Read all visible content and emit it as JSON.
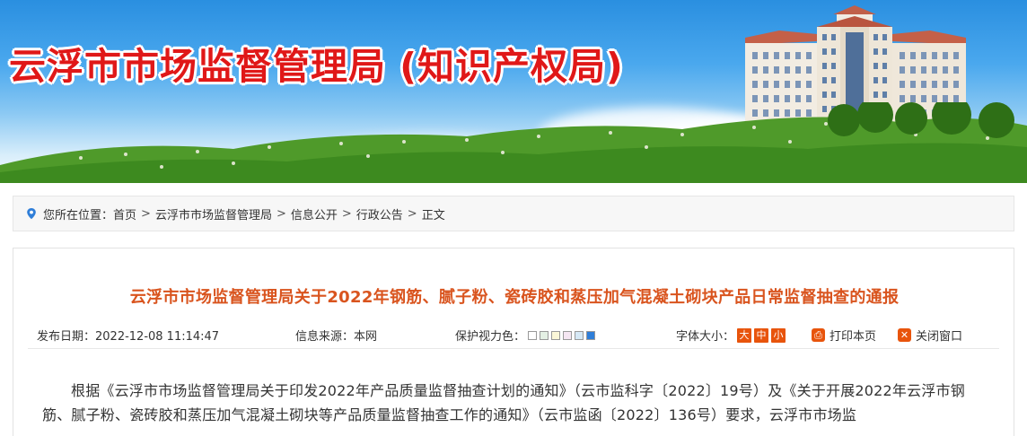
{
  "banner": {
    "title": "云浮市市场监督管理局 (知识产权局)"
  },
  "breadcrumb": {
    "prefix": "您所在位置：",
    "items": [
      "首页",
      "云浮市市场监督管理局",
      "信息公开",
      "行政公告",
      "正文"
    ],
    "separator": ">"
  },
  "article": {
    "title": "云浮市市场监督管理局关于2022年钢筋、腻子粉、瓷砖胶和蒸压加气混凝土砌块产品日常监督抽查的通报",
    "publish_date": "发布日期：2022-12-08 11:14:47",
    "source": "信息来源：本网",
    "eye_care_label": "保护视力色：",
    "eye_care_colors": [
      "#ffffff",
      "#e4f0e4",
      "#fbf7d8",
      "#f5e6f2",
      "#d6e8f5",
      "#2f7ed8"
    ],
    "font_size_label": "字体大小：",
    "font_sizes": [
      "大",
      "中",
      "小"
    ],
    "print_label": "打印本页",
    "close_label": "关闭窗口",
    "body": "根据《云浮市市场监督管理局关于印发2022年产品质量监督抽查计划的通知》（云市监科字〔2022〕19号）及《关于开展2022年云浮市钢筋、腻子粉、瓷砖胶和蒸压加气混凝土砌块等产品质量监督抽查工作的通知》（云市监函〔2022〕136号）要求，云浮市市场监"
  },
  "colors": {
    "banner_title": "#e01818",
    "article_title": "#d9541e",
    "accent_orange": "#e8540c",
    "breadcrumb_bg": "#f7f7f7",
    "location_pin": "#2f7ed8"
  },
  "icons": {
    "location": "location-pin-icon",
    "print": "printer-icon",
    "close": "close-window-icon"
  }
}
